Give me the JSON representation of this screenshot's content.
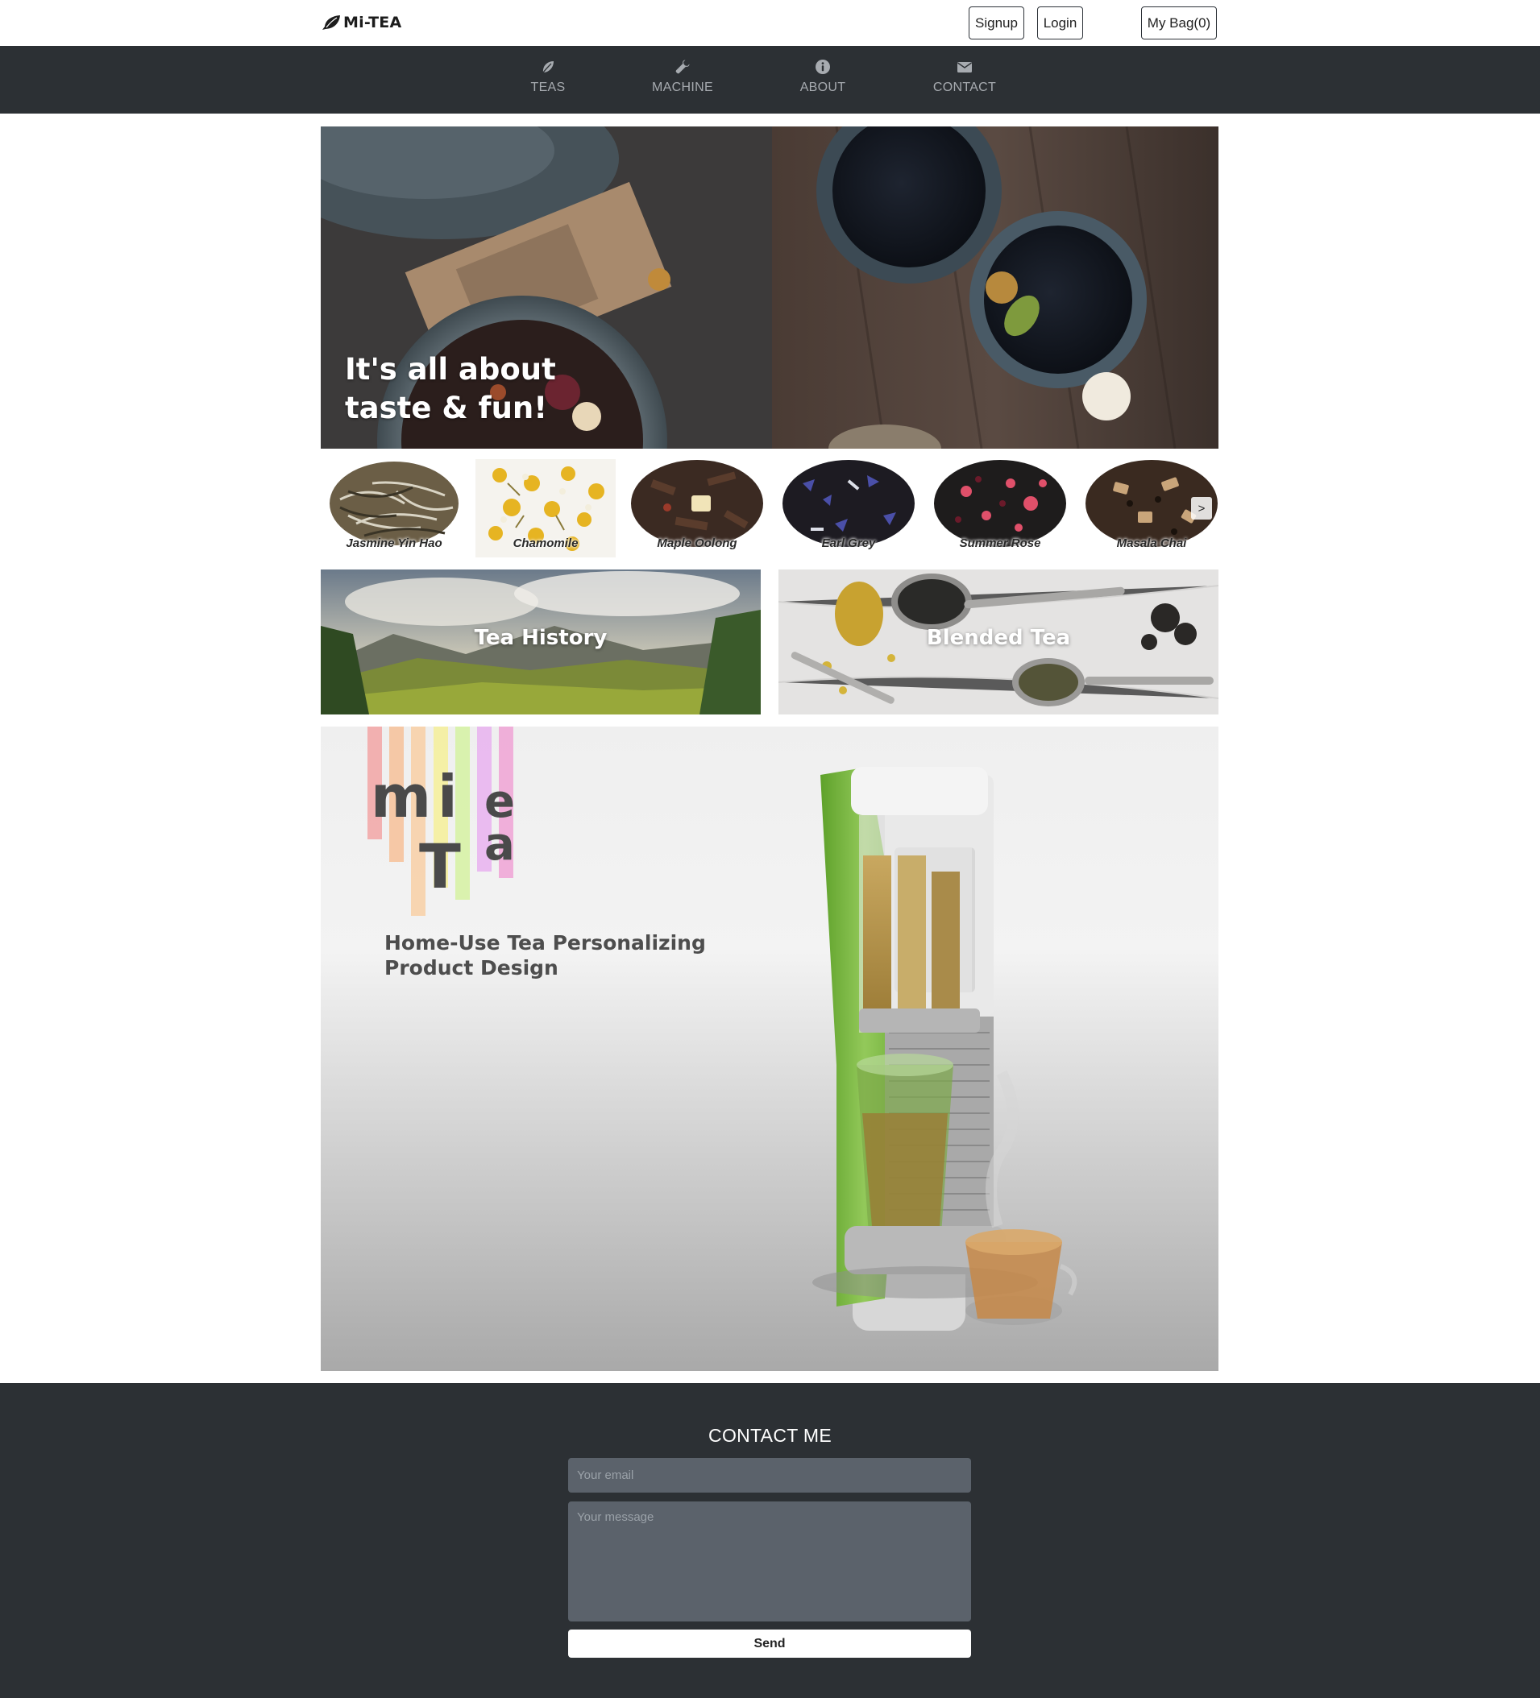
{
  "header": {
    "logo_text": "Mi-TEA",
    "logo_icon": "leaf-icon",
    "signup_label": "Signup",
    "login_label": "Login",
    "bag_label": "My Bag(0)"
  },
  "nav": {
    "items": [
      {
        "label": "TEAS",
        "icon": "leaf-icon"
      },
      {
        "label": "MACHINE",
        "icon": "wrench-icon"
      },
      {
        "label": "ABOUT",
        "icon": "info-icon"
      },
      {
        "label": "CONTACT",
        "icon": "envelope-icon"
      }
    ]
  },
  "hero": {
    "caption_line1": "It's all about",
    "caption_line2": "taste & fun!"
  },
  "teas": {
    "items": [
      {
        "name": "Jasmine Yin Hao"
      },
      {
        "name": "Chamomile"
      },
      {
        "name": "Maple Oolong"
      },
      {
        "name": "Earl Grey"
      },
      {
        "name": "Summer Rose"
      },
      {
        "name": "Masala Chai"
      }
    ],
    "next_label": ">"
  },
  "tiles": {
    "history_title": "Tea History",
    "blended_title": "Blended Tea"
  },
  "machine": {
    "logo_letters": "mieTa",
    "subtitle_line1": "Home-Use Tea Personalizing",
    "subtitle_line2": "Product Design"
  },
  "contact": {
    "title": "CONTACT ME",
    "email_placeholder": "Your email",
    "email_value": "",
    "message_placeholder": "Your message",
    "message_value": "",
    "send_label": "Send"
  },
  "colors": {
    "nav_background": "#2c3034",
    "nav_text": "#a7abb0",
    "field_background": "#5b626b",
    "machine_accent_green": "#7cc041"
  }
}
